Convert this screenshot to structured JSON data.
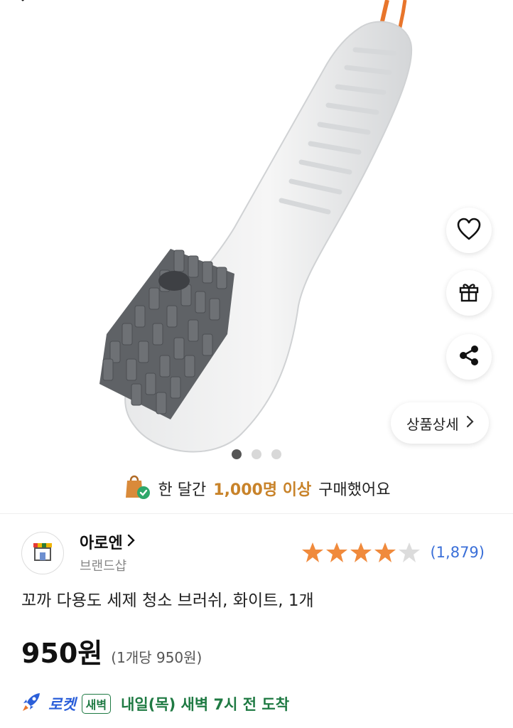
{
  "hero": {
    "icons": [
      "back-arrow-icon",
      "heart-icon",
      "gift-icon",
      "share-icon"
    ],
    "detail_button": "상품상세",
    "carousel": {
      "total": 3,
      "active": 1
    }
  },
  "social_proof": {
    "prefix": "한 달간",
    "highlight": "1,000명 이상",
    "suffix": "구매했어요"
  },
  "brand": {
    "name": "아로엔",
    "type": "브랜드샵"
  },
  "rating": {
    "stars": 4.5,
    "count": "(1,879)"
  },
  "product": {
    "title": "꼬까 다용도 세제 청소 브러쉬, 화이트, 1개",
    "price": "950원",
    "unit_price": "(1개당 950원)"
  },
  "delivery": {
    "rocket": "로켓",
    "badge": "새벽",
    "text": "내일(목) 새벽 7시 전 도착"
  },
  "colors": {
    "highlight": "#c8832a",
    "star": "#f08a3c",
    "rating_count": "#3a6fd8",
    "delivery_green": "#1f7a43",
    "rocket_blue": "#2b5fd9"
  }
}
